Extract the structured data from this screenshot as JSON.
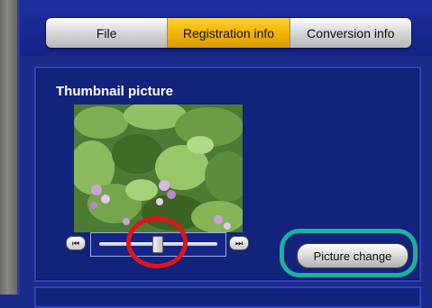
{
  "tabs": [
    {
      "label": "File",
      "active": false
    },
    {
      "label": "Registration info",
      "active": true
    },
    {
      "label": "Conversion info",
      "active": false
    }
  ],
  "section": {
    "title": "Thumbnail picture"
  },
  "slider": {
    "position": 0.5
  },
  "buttons": {
    "prev_icon": "skip-start-icon",
    "next_icon": "skip-end-icon",
    "picture_change": "Picture change"
  },
  "colors": {
    "background": "#1c2a8a",
    "active_tab": "#f2b400",
    "highlight_teal": "#17b3a0",
    "highlight_red": "#e0141a"
  }
}
